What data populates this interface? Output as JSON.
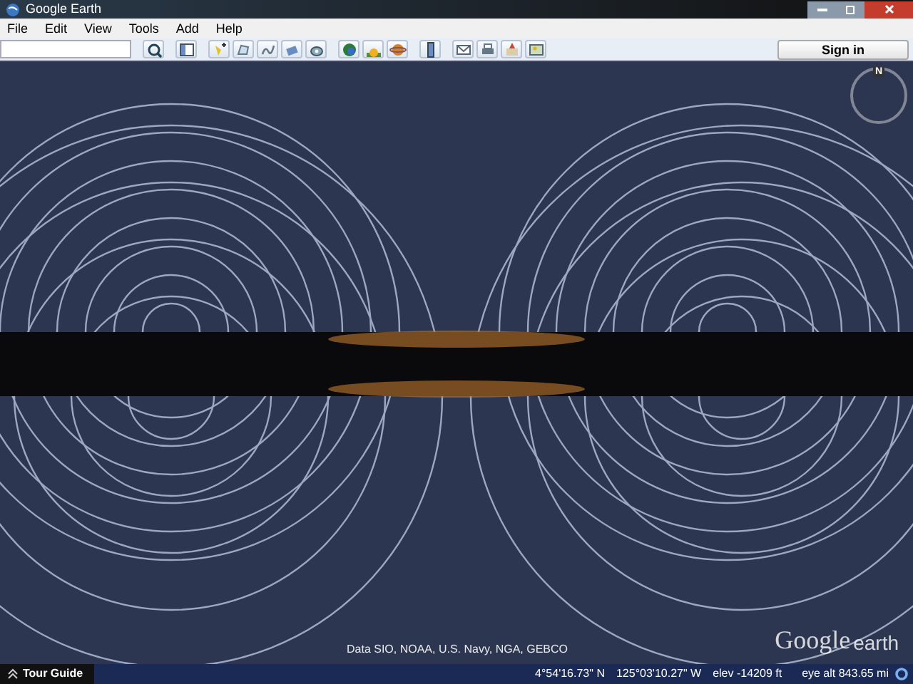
{
  "window": {
    "title": "Google Earth"
  },
  "menu": [
    "File",
    "Edit",
    "View",
    "Tools",
    "Add",
    "Help"
  ],
  "toolbar": {
    "groups": [
      [
        {
          "kind": "search"
        }
      ],
      [
        {
          "kind": "sidebar"
        }
      ],
      [
        {
          "kind": "placemark"
        },
        {
          "kind": "polygon"
        },
        {
          "kind": "path"
        },
        {
          "kind": "overlay"
        },
        {
          "kind": "tour"
        }
      ],
      [
        {
          "kind": "history"
        },
        {
          "kind": "sun"
        },
        {
          "kind": "planets"
        }
      ],
      [
        {
          "kind": "ruler"
        }
      ],
      [
        {
          "kind": "email"
        },
        {
          "kind": "print"
        },
        {
          "kind": "map"
        },
        {
          "kind": "image"
        }
      ]
    ]
  },
  "sign_in": "Sign in",
  "compass": {
    "label": "N"
  },
  "logo": {
    "word1": "Google",
    "word2": "earth"
  },
  "attribution": "Data SIO, NOAA, U.S. Navy, NGA, GEBCO",
  "tour_guide": {
    "label": "Tour Guide",
    "expanded": false
  },
  "status": {
    "latitude": "4°54'16.73\" N",
    "longitude": "125°03'10.27\" W",
    "elevation": "elev -14209 ft",
    "eye_alt": "eye alt 843.65 mi"
  }
}
